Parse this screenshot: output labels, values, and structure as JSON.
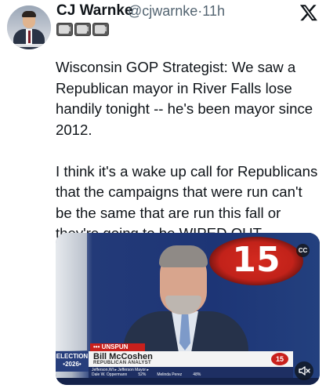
{
  "post": {
    "author": {
      "name": "CJ Warnke",
      "handle": "@cjwarnke",
      "separator": "·",
      "time": "11h",
      "emoji_icons": [
        "tv-icon",
        "tv-icon",
        "tv-icon"
      ]
    },
    "platform_icon": "x-logo-icon",
    "text": "Wisconsin GOP Strategist: We saw a\nRepublican mayor in River Falls lose\nhandily tonight -- he's been mayor since\n2012.\n\nI think it's a wake up call for Republicans\nthat the campaigns that were run can't\nbe the same that are run this fall or\nthey're going to be WIPED OUT."
  },
  "video": {
    "station_logo": "15",
    "cc_label": "CC",
    "chyron": {
      "tag": "••• UNSPUN",
      "election_label_line1": "ELECTION",
      "election_label_line2": "•2026•",
      "name": "Bill McCoshen",
      "role": "REPUBLICAN ANALYST",
      "logo": "15"
    },
    "ticker": {
      "line1": "Jefferson,WI ▸ Jefferson Mayor ▸",
      "entries": [
        {
          "name": "Dale W. Oppermann",
          "pct": "52%"
        },
        {
          "name": "Melinda Perez",
          "pct": "48%"
        }
      ]
    },
    "mute_icon": "speaker-mute-icon"
  }
}
